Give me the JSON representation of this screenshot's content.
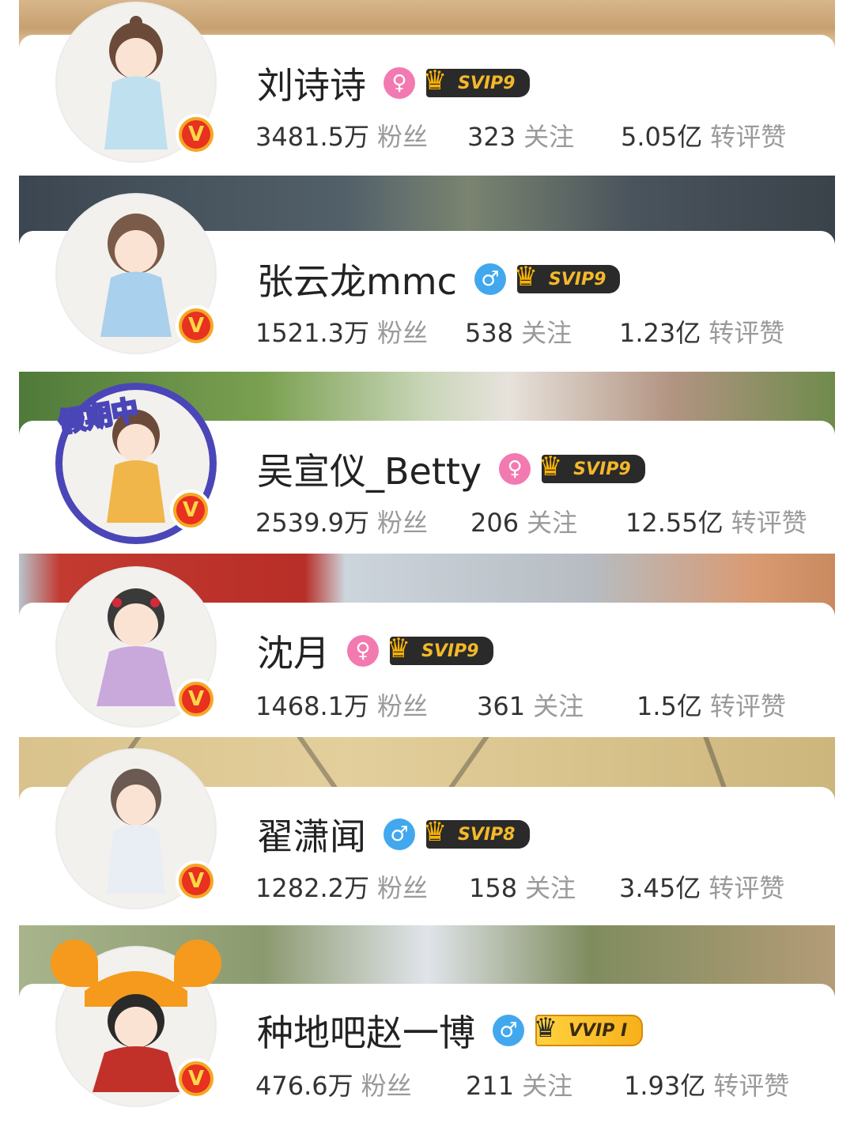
{
  "accounts": [
    {
      "name": "刘诗诗",
      "gender": "♀",
      "gender_type": "female",
      "vip": "SVIP9",
      "vip_style": "dark",
      "followers": "3481.5万",
      "followers_label": "粉丝",
      "following": "323",
      "following_label": "关注",
      "engagement": "5.05亿",
      "engagement_label": "转评赞",
      "verified": "V"
    },
    {
      "name": "张云龙mmc",
      "gender": "♂",
      "gender_type": "male",
      "vip": "SVIP9",
      "vip_style": "dark",
      "followers": "1521.3万",
      "followers_label": "粉丝",
      "following": "538",
      "following_label": "关注",
      "engagement": "1.23亿",
      "engagement_label": "转评赞",
      "verified": "V"
    },
    {
      "name": "吴宣仪_Betty",
      "gender": "♀",
      "gender_type": "female",
      "vip": "SVIP9",
      "vip_style": "dark",
      "followers": "2539.9万",
      "followers_label": "粉丝",
      "following": "206",
      "following_label": "关注",
      "engagement": "12.55亿",
      "engagement_label": "转评赞",
      "verified": "V",
      "avatar_tag": "假期中"
    },
    {
      "name": "沈月",
      "gender": "♀",
      "gender_type": "female",
      "vip": "SVIP9",
      "vip_style": "dark",
      "followers": "1468.1万",
      "followers_label": "粉丝",
      "following": "361",
      "following_label": "关注",
      "engagement": "1.5亿",
      "engagement_label": "转评赞",
      "verified": "V"
    },
    {
      "name": "翟潇闻",
      "gender": "♂",
      "gender_type": "male",
      "vip": "SVIP8",
      "vip_style": "dark",
      "followers": "1282.2万",
      "followers_label": "粉丝",
      "following": "158",
      "following_label": "关注",
      "engagement": "3.45亿",
      "engagement_label": "转评赞",
      "verified": "V"
    },
    {
      "name": "种地吧赵一博",
      "gender": "♂",
      "gender_type": "male",
      "vip": "VVIP I",
      "vip_style": "gold",
      "followers": "476.6万",
      "followers_label": "粉丝",
      "following": "211",
      "following_label": "关注",
      "engagement": "1.93亿",
      "engagement_label": "转评赞",
      "verified": "V"
    }
  ],
  "icons": {
    "crown": "crown-icon",
    "verified": "verified-v-icon"
  },
  "colors": {
    "female": "#f27ab0",
    "male": "#42a8ee",
    "verified": "#e8311f",
    "vip_text": "#f4b82a"
  }
}
